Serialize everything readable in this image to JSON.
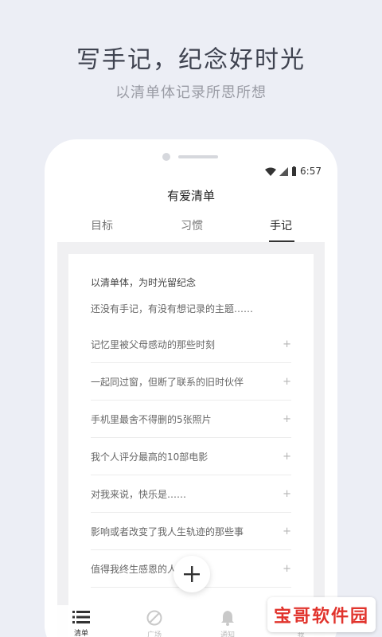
{
  "promo": {
    "title": "写手记，纪念好时光",
    "subtitle": "以清单体记录所思所想"
  },
  "status": {
    "time": "6:57"
  },
  "screen": {
    "title": "有爱清单"
  },
  "tabs": [
    {
      "label": "目标"
    },
    {
      "label": "习惯"
    },
    {
      "label": "手记",
      "active": true
    }
  ],
  "card": {
    "heading": "以清单体，为时光留纪念",
    "empty_hint": "还没有手记，有没有想记录的主题……",
    "prompts": [
      "记忆里被父母感动的那些时刻",
      "一起同过窗，但断了联系的旧时伙伴",
      "手机里最舍不得删的5张照片",
      "我个人评分最高的10部电影",
      "对我来说，快乐是……",
      "影响或者改变了我人生轨迹的那些事",
      "值得我终生感恩的人"
    ],
    "plus_symbol": "+"
  },
  "fab": {
    "icon": "plus-icon"
  },
  "bottom_nav": [
    {
      "label": "清单",
      "icon": "list-icon",
      "active": true
    },
    {
      "label": "广场",
      "icon": "plaza-icon"
    },
    {
      "label": "通知",
      "icon": "bell-icon"
    },
    {
      "label": "我",
      "icon": "person-icon"
    }
  ],
  "watermark": {
    "text": "宝哥软件园"
  },
  "colors": {
    "background": "#eceef5",
    "text_dark": "#3f4350",
    "watermark_red": "#e1342d"
  }
}
